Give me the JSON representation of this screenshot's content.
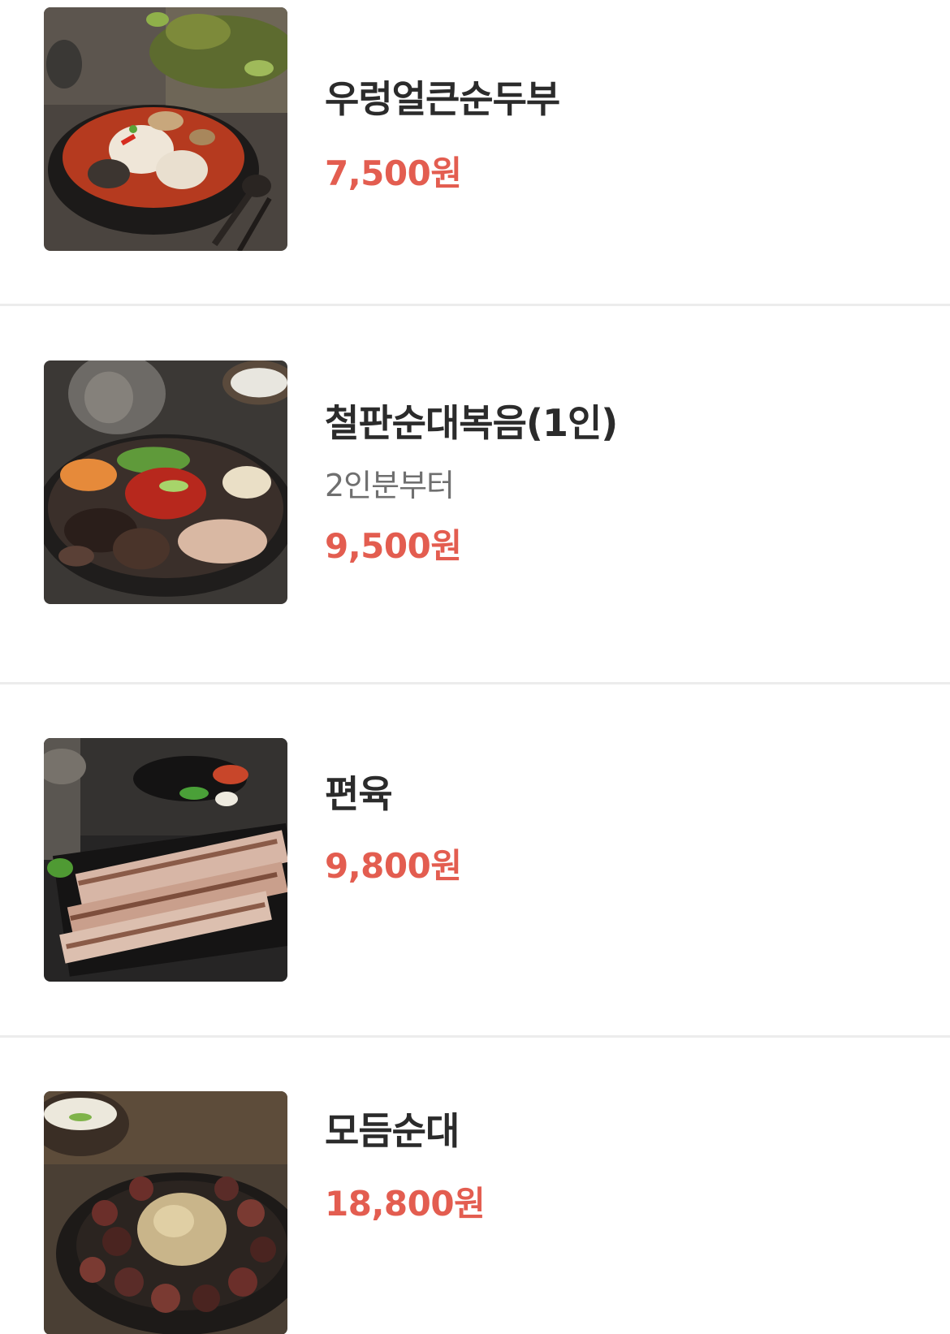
{
  "menu": {
    "items": [
      {
        "name": "우렁얼큰순두부",
        "note": "",
        "price": "7,500원",
        "image": "spicy-soft-tofu-stew-photo"
      },
      {
        "name": "철판순대복음(1인)",
        "note": "2인분부터",
        "price": "9,500원",
        "image": "iron-plate-stir-fried-sundae-photo"
      },
      {
        "name": "편육",
        "note": "",
        "price": "9,800원",
        "image": "sliced-pork-pyeonyuk-photo"
      },
      {
        "name": "모듬순대",
        "note": "",
        "price": "18,800원",
        "image": "assorted-sundae-photo"
      }
    ]
  },
  "colors": {
    "price": "#e35d50",
    "name": "#2b2b2b",
    "note": "#6f6f6f",
    "divider": "#ececec"
  }
}
